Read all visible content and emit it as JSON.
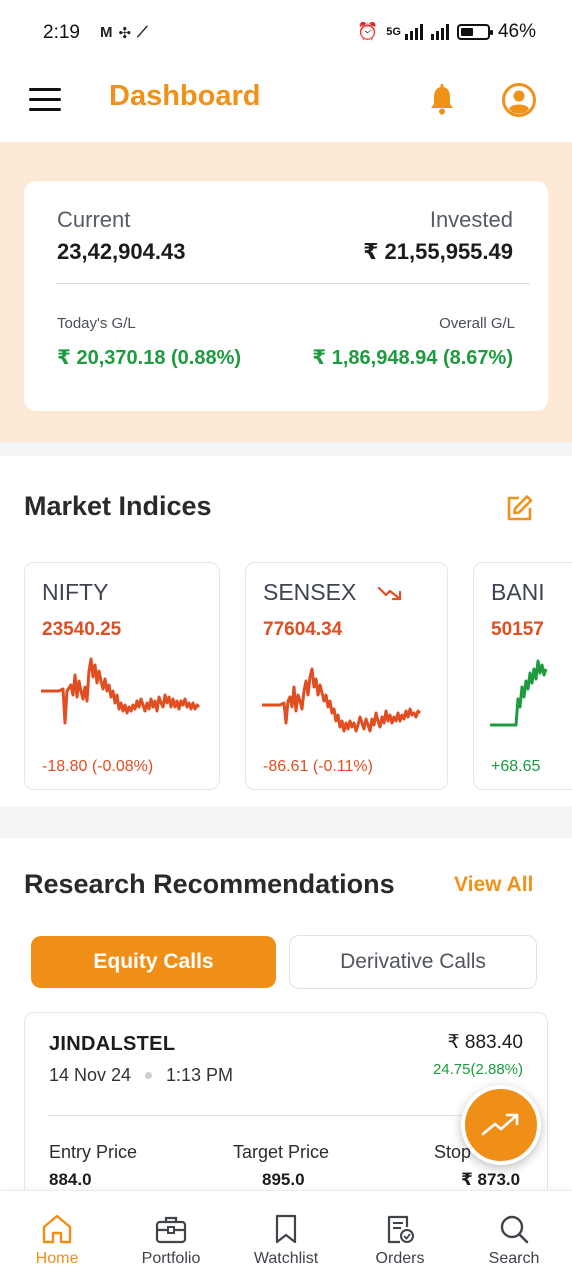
{
  "status_bar": {
    "time": "2:19",
    "notif_icons": [
      "gmail-icon",
      "slack-icon",
      "app-icon"
    ],
    "network": "5G",
    "battery": "46%",
    "battery_level": 0.46
  },
  "header": {
    "title": "Dashboard",
    "icons": [
      "menu-icon",
      "bell-icon",
      "profile-icon"
    ]
  },
  "portfolio": {
    "current_label": "Current",
    "current_value": "23,42,904.43",
    "invested_label": "Invested",
    "invested_value": "₹ 21,55,955.49",
    "todays_gl_label": "Today's G/L",
    "todays_gl_value": "₹ 20,370.18 (0.88%)",
    "overall_gl_label": "Overall G/L",
    "overall_gl_value": "₹ 1,86,948.94 (8.67%)"
  },
  "market_indices": {
    "title": "Market Indices",
    "edit_icon": "edit-icon",
    "items": [
      {
        "name": "NIFTY",
        "value": "23540.25",
        "change": "-18.80 (-0.08%)",
        "trend": "down",
        "color": "#e04e22"
      },
      {
        "name": "SENSEX",
        "value": "77604.34",
        "change": "-86.61 (-0.11%)",
        "trend": "down",
        "color": "#e04e22",
        "trend_icon": "trending-down-icon"
      },
      {
        "name": "BANI",
        "value": "50157",
        "change": "+68.65",
        "trend": "up",
        "color": "#1e9b3e"
      }
    ]
  },
  "research": {
    "title": "Research Recommendations",
    "view_all": "View All",
    "tabs": [
      {
        "label": "Equity Calls",
        "active": true
      },
      {
        "label": "Derivative Calls",
        "active": false
      }
    ],
    "calls": [
      {
        "symbol": "JINDALSTEL",
        "date": "14 Nov 24",
        "time": "1:13 PM",
        "price": "₹ 883.40",
        "change": "24.75(2.88%)",
        "entry_label": "Entry Price",
        "entry_value": "884.0",
        "target_label": "Target Price",
        "target_value": "895.0",
        "stop_label": "Stop",
        "stop_value": "₹ 873.0"
      }
    ]
  },
  "fab": {
    "icon": "trending-up-icon"
  },
  "bottom_nav": [
    {
      "label": "Home",
      "icon": "home-icon",
      "active": true
    },
    {
      "label": "Portfolio",
      "icon": "briefcase-icon",
      "active": false
    },
    {
      "label": "Watchlist",
      "icon": "bookmark-icon",
      "active": false
    },
    {
      "label": "Orders",
      "icon": "orders-icon",
      "active": false
    },
    {
      "label": "Search",
      "icon": "search-icon",
      "active": false
    }
  ],
  "colors": {
    "accent": "#f0921a",
    "loss": "#e04e22",
    "gain": "#1e9b3e",
    "summary_bg": "#fde9d5"
  }
}
